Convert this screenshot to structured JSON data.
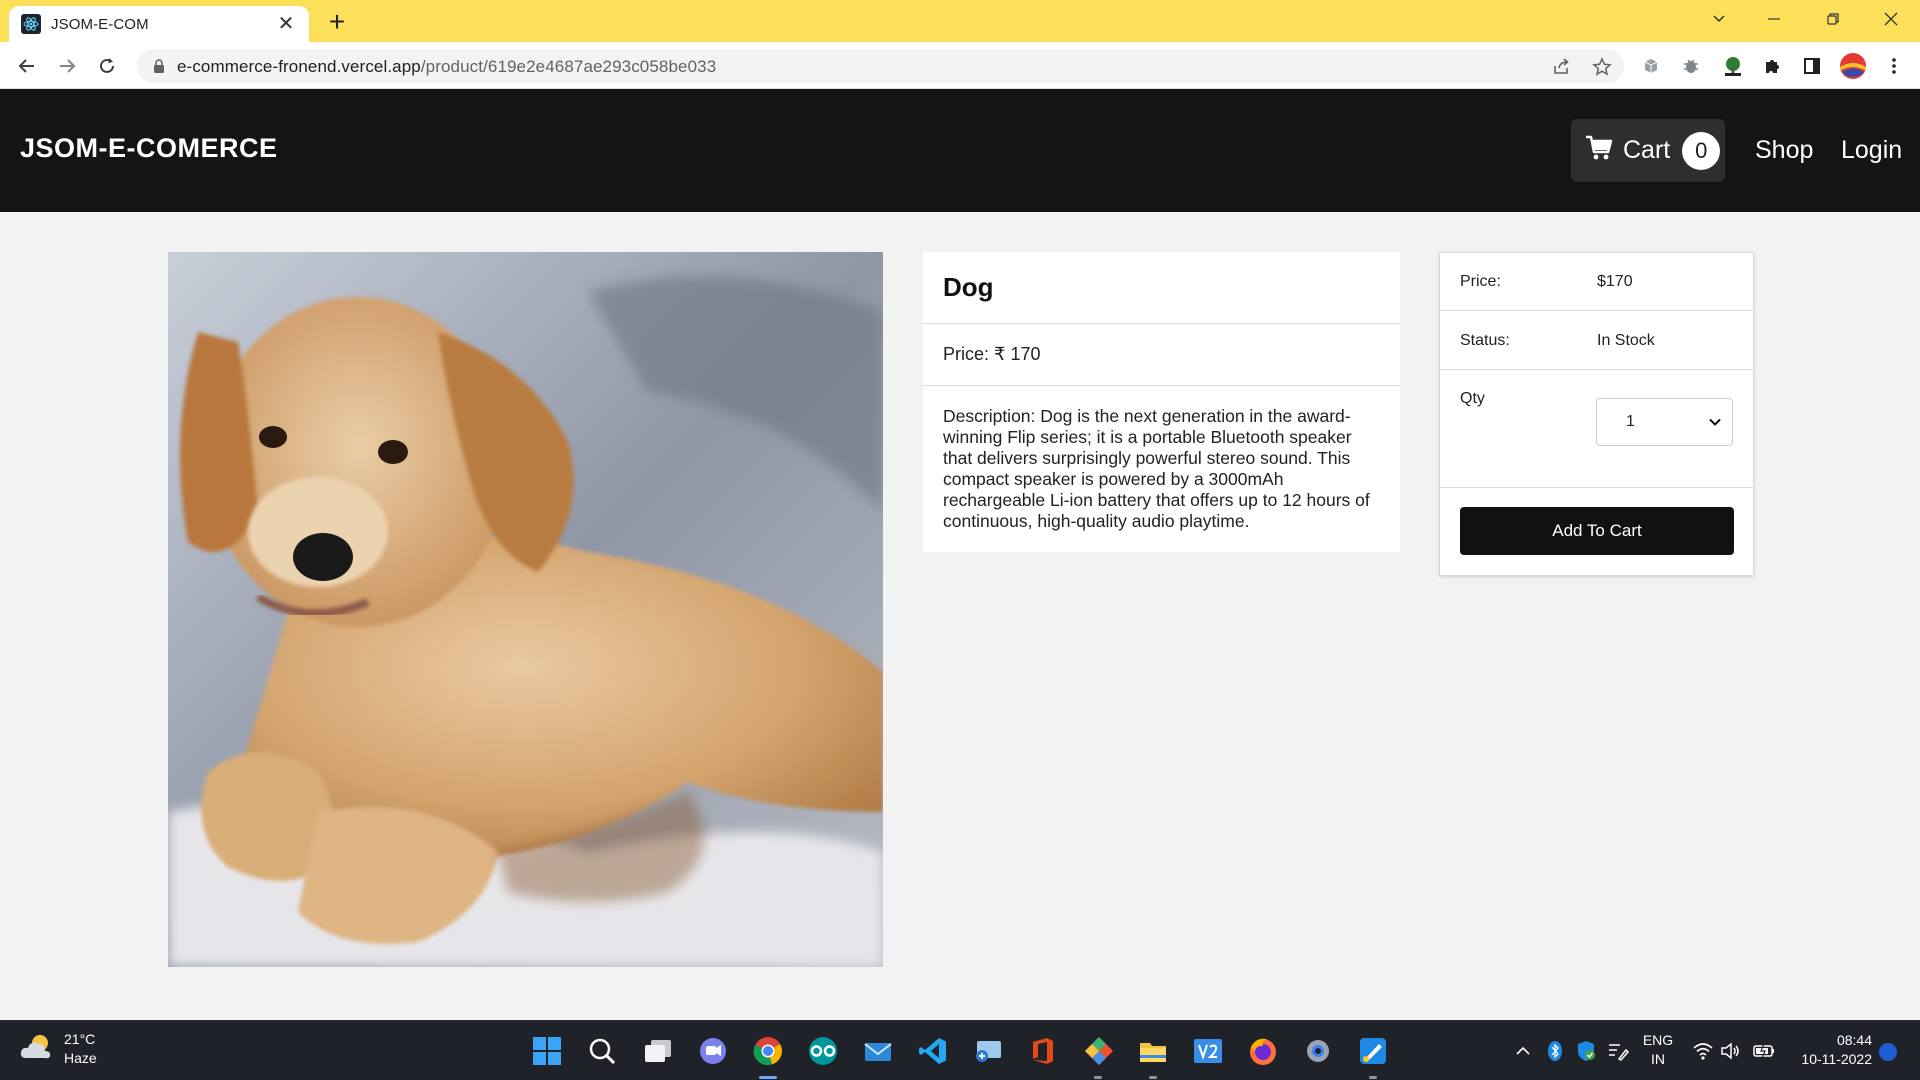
{
  "browser": {
    "tab_title": "JSOM-E-COM",
    "url_domain": "e-commerce-fronend.vercel.app",
    "url_path": "/product/619e2e4687ae293c058be033"
  },
  "navbar": {
    "brand": "JSOM-E-COMERCE",
    "cart_label": "Cart",
    "cart_count": "0",
    "shop_label": "Shop",
    "login_label": "Login"
  },
  "product": {
    "name": "Dog",
    "price_line": "Price: ₹ 170",
    "description": "Description: Dog is the next generation in the award-winning Flip series; it is a portable Bluetooth speaker that delivers surprisingly powerful stereo sound. This compact speaker is powered by a 3000mAh rechargeable Li-ion battery that offers up to 12 hours of continuous, high-quality audio playtime."
  },
  "buybox": {
    "price_label": "Price:",
    "price_value": "$170",
    "status_label": "Status:",
    "status_value": "In Stock",
    "qty_label": "Qty",
    "qty_value": "1",
    "add_button": "Add To Cart"
  },
  "taskbar": {
    "temperature": "21°C",
    "weather": "Haze",
    "lang_top": "ENG",
    "lang_bottom": "IN",
    "time": "08:44",
    "date": "10-11-2022"
  },
  "colors": {
    "tabstrip": "#fde05a",
    "navbar": "#141414",
    "button": "#111111",
    "page": "#f2f2f2"
  }
}
